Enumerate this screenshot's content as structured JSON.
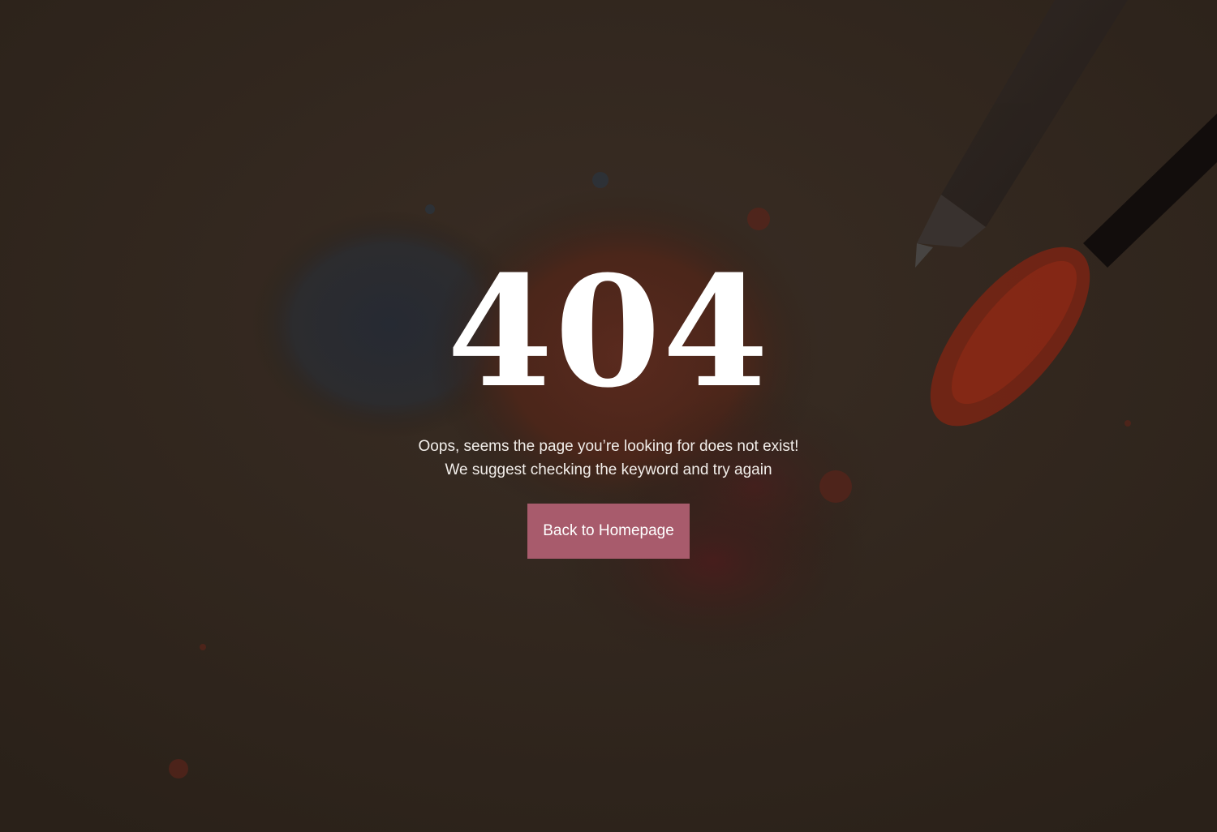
{
  "error": {
    "code": "404",
    "message_line1": "Oops, seems the page you’re looking for does not exist!",
    "message_line2": "We suggest checking the keyword and try again"
  },
  "actions": {
    "home_button_label": "Back to Homepage"
  },
  "colors": {
    "background_overlay": "#2a2119",
    "button": "#a85b6c",
    "text": "#ffffff"
  },
  "background": {
    "description_icon": "makeup-powder-and-brushes-photo"
  }
}
